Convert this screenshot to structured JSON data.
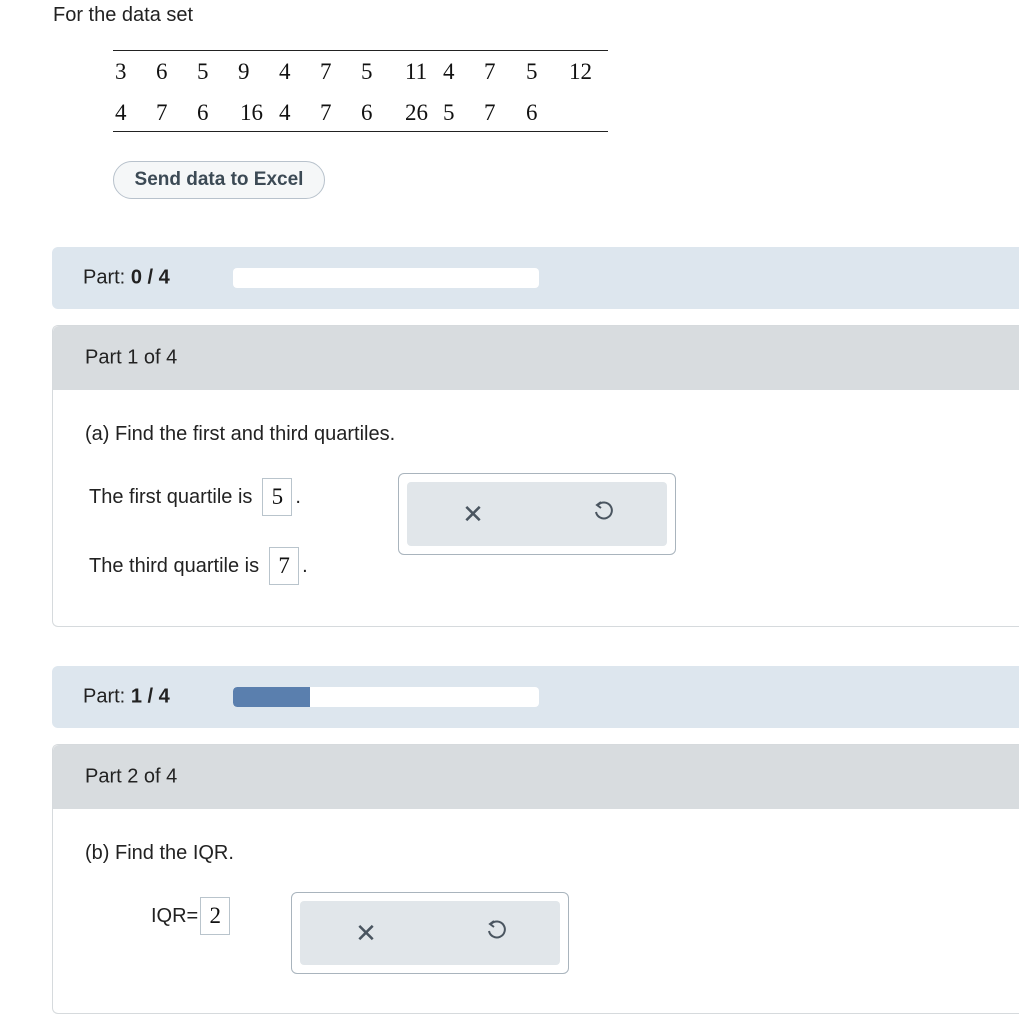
{
  "intro": "For the data set",
  "data_rows": [
    [
      "3",
      "6",
      "5",
      "9",
      "4",
      "7",
      "5",
      "11",
      "4",
      "7",
      "5",
      "12"
    ],
    [
      "4",
      "7",
      "6",
      "16",
      "4",
      "7",
      "6",
      "26",
      "5",
      "7",
      "6"
    ]
  ],
  "excel_button": "Send data to Excel",
  "progress1": {
    "label": "Part:",
    "value": "0 / 4",
    "fraction": 0
  },
  "part1": {
    "header": "Part 1 of 4",
    "question": "(a) Find the first and third quartiles.",
    "first_prefix": "The first quartile is",
    "first_value": "5",
    "third_prefix": "The third quartile is",
    "third_value": "7",
    "period": "."
  },
  "progress2": {
    "label": "Part:",
    "value": "1 / 4",
    "fraction": 0.25
  },
  "part2": {
    "header": "Part 2 of 4",
    "question": "(b) Find the IQR.",
    "iqr_label": "IQR=",
    "iqr_value": "2"
  },
  "icons": {
    "clear": "x-icon",
    "undo": "undo-icon"
  }
}
